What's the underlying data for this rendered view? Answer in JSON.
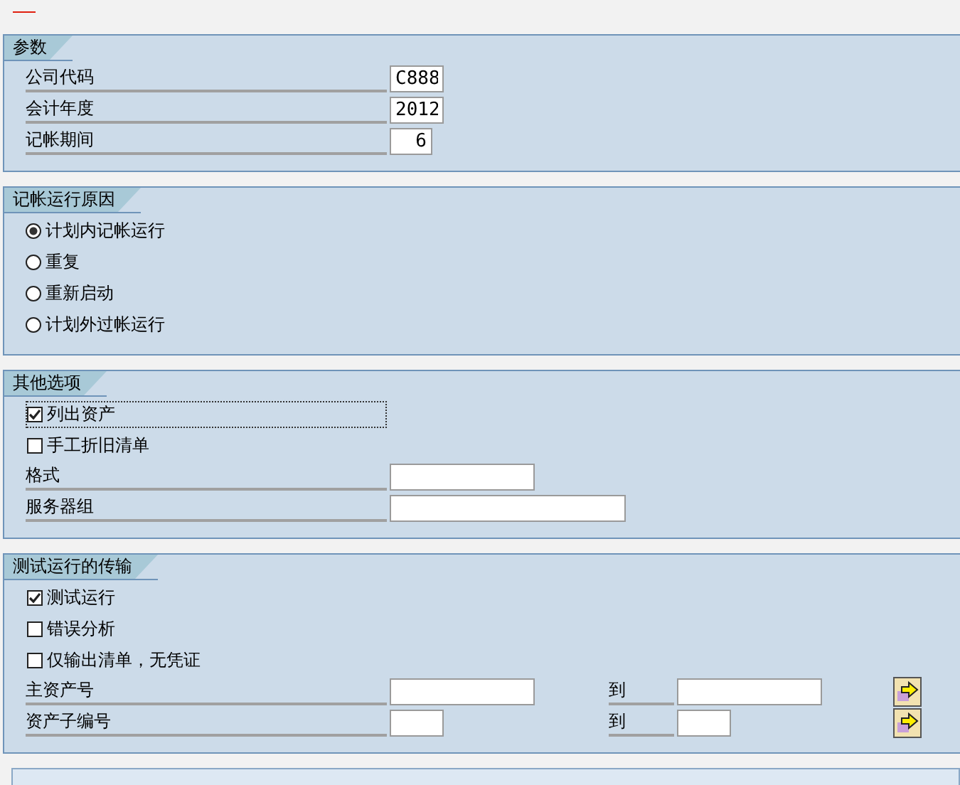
{
  "sections": [
    {
      "title": "参数",
      "rows": [
        {
          "kind": "field",
          "label": "公司代码",
          "value": "C888"
        },
        {
          "kind": "field",
          "label": "会计年度",
          "value": "2012"
        },
        {
          "kind": "field",
          "label": "记帐期间",
          "value": "6",
          "right_aligned": true
        }
      ]
    },
    {
      "title": "记帐运行原因",
      "rows": [
        {
          "kind": "radio",
          "label": "计划内记帐运行",
          "selected": true
        },
        {
          "kind": "radio",
          "label": "重复",
          "selected": false
        },
        {
          "kind": "radio",
          "label": "重新启动",
          "selected": false
        },
        {
          "kind": "radio",
          "label": "计划外过帐运行",
          "selected": false
        }
      ]
    },
    {
      "title": "其他选项",
      "rows": [
        {
          "kind": "checkbox",
          "label": "列出资产",
          "checked": true,
          "focused": true
        },
        {
          "kind": "checkbox",
          "label": "手工折旧清单",
          "checked": false,
          "focused": false
        },
        {
          "kind": "field",
          "label": "格式"
        },
        {
          "kind": "field",
          "label": "服务器组"
        }
      ]
    },
    {
      "title": "测试运行的传输",
      "rows": [
        {
          "kind": "checkbox",
          "label": "测试运行",
          "checked": true,
          "focused": false
        },
        {
          "kind": "checkbox",
          "label": "错误分析",
          "checked": false,
          "focused": false
        },
        {
          "kind": "checkbox",
          "label": "仅输出清单，无凭证",
          "checked": false,
          "focused": false
        },
        {
          "kind": "range",
          "label": "主资产号",
          "to_label": "到"
        },
        {
          "kind": "range",
          "label": "资产子编号",
          "to_label": "到"
        }
      ]
    }
  ]
}
